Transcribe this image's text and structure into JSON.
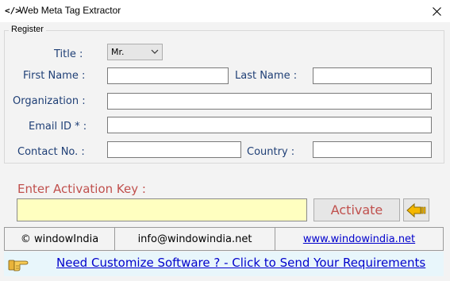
{
  "window": {
    "icon": "</>",
    "title": "Web Meta Tag Extractor"
  },
  "register": {
    "legend": "Register",
    "title_label": "Title :",
    "title_value": "Mr.",
    "first_name_label": "First Name :",
    "last_name_label": "Last Name :",
    "organization_label": "Organization :",
    "email_label": "Email ID * :",
    "contact_label": "Contact No. :",
    "country_label": "Country :",
    "first_name_value": "",
    "last_name_value": "",
    "organization_value": "",
    "email_value": "",
    "contact_value": "",
    "country_value": ""
  },
  "activation": {
    "label": "Enter Activation Key  :",
    "key_value": "",
    "button_label": "Activate"
  },
  "footer": {
    "copyright": "© windowIndia",
    "email": "info@windowindia.net",
    "website": "www.windowindia.net",
    "customize_link": "Need Customize Software ? - Click to Send Your Requirements"
  },
  "colors": {
    "label_blue": "#1f3f76",
    "accent_red": "#c0504d",
    "key_field_bg": "#ffffc0",
    "link_blue": "#0000cc",
    "customize_bar_bg": "#e8f6fb"
  },
  "icons": {
    "close": "close-icon",
    "activate_arrow": "left-arrow-icon",
    "hand": "pointing-hand-icon"
  }
}
